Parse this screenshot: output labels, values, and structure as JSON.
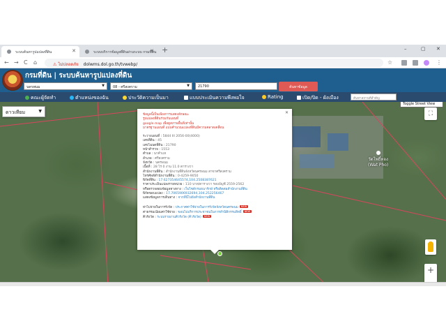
{
  "browser": {
    "tabs": [
      {
        "title": "ระบบค้นหารูปแปลงที่ดิน",
        "active": true
      },
      {
        "title": "ระบบบริการข้อมูลที่ดินผ่านระบบ กรมที่ดิน",
        "active": false
      }
    ],
    "new_tab_label": "+",
    "window_controls": {
      "minimize": "–",
      "maximize": "▢",
      "close": "✕"
    },
    "nav": {
      "back": "←",
      "forward": "→",
      "reload": "C",
      "home": "⌂"
    },
    "address": {
      "security_icon": "warning-icon",
      "insecure_label": "ไม่ปลอดภัย",
      "url": "dolwms.dol.go.th/tvwebp/"
    },
    "star_icon": "☆"
  },
  "app": {
    "logo_icon": "dol-seal",
    "title": "กรมที่ดิน | ระบบค้นหารูปแปลงที่ดิน",
    "search": {
      "province": "นครพนม",
      "district": "08 - ศรีสงคราม",
      "parcel_number": "21790",
      "search_button": "ค้นหาข้อมูล"
    },
    "menu": [
      {
        "label": "คณะผู้จัดทำ",
        "icon": "team-icon",
        "icon_color": "#4caf50"
      },
      {
        "label": "ตำแหน่งของฉัน",
        "icon": "location-icon",
        "icon_color": "#29b6f6"
      },
      {
        "label": "ประวัติความเป็นมา",
        "icon": "history-icon",
        "icon_color": "#fdd835"
      },
      {
        "label": "แบบประเมินความพึงพอใจ",
        "icon": "survey-icon",
        "icon_color": "#ffffff"
      },
      {
        "label": "Rating",
        "icon": "rating-icon",
        "icon_color": "#ffca28"
      },
      {
        "label": "เปิด/ปิด - ผังเมือง",
        "icon": "layers-icon",
        "icon_color": "#ffffff"
      }
    ],
    "place_search_placeholder": "ค้นหาสถานที่สำคัญ"
  },
  "map": {
    "type_button": "ดาวเทียม",
    "streetview_tooltip": "Toggle Street View",
    "place_label": "วัดโพธิ์ทอง",
    "place_label_sub": "(Wat Pho)",
    "zoom_in": "+",
    "zoom_out": "−",
    "parcel_line_color": "#d9455f"
  },
  "info_window": {
    "notice": [
      "ข้อมูลนี้เป็นเพียงการแสดงลักษณะ",
      "รูปแปลงที่ดินร่วมกับแผนที่",
      "google map เพื่อดูสภาพพื้นที่เท่านั้น",
      "มาตรฐานแผนที่ แบบคำนวณแปลงที่ดินมีความคลาดเคลื่อน"
    ],
    "fields": [
      {
        "label": "ระวางแผนที่",
        "value": "5844 III 2056-00(4000)"
      },
      {
        "label": "เลขที่ดิน",
        "value": "45"
      },
      {
        "label": "เลขโฉนดที่ดิน",
        "value": "21790"
      },
      {
        "label": "หน้าสำรวจ",
        "value": "1553"
      },
      {
        "label": "ตำบล",
        "value": "นาคำแห"
      },
      {
        "label": "อำเภอ",
        "value": "ศรีสงคราม"
      },
      {
        "label": "จังหวัด",
        "value": "นครพนม"
      },
      {
        "label": "เนื้อที่",
        "value": "28 ไร่ 0 งาน 11.0 ตารางวา"
      },
      {
        "label": "สำนักงานที่ดิน",
        "value": "สำนักงานที่ดินจังหวัดนครพนม สาขาศรีสงคราม"
      },
      {
        "label": "โทรศัพท์สำนักงานที่ดิน",
        "value": "0-4259-9050"
      },
      {
        "label": "พิกัดที่ดิน",
        "value": "17.627354645574,104.2508387621",
        "link": true
      },
      {
        "label": "ราคาประเมินแปลงรายหน่วย",
        "value": "110 บาท/ตารางวา รอบบัญชี 2559-2562"
      },
      {
        "label": "หรือตรวจสอบข้อมูลทางหาง",
        "value": "เว็บไซต์กรมธนารักษ์ หรือติดต่อสำนักงานที่ดิน",
        "link": true
      },
      {
        "label": "พิกัดขอบแปลง",
        "value": "17.7065906932694,104.252256467",
        "link": true
      },
      {
        "label": "แสดงข้อมูลการเดินทาง",
        "value": "จากที่นี่ไปยังสำนักงานที่ดิน",
        "link": true
      }
    ],
    "extra_links": [
      {
        "label": "ท่าไปจ่ายในการรังวัด",
        "value": "ประกาศค่าใช้จ่ายในการรังวัดจังหวัดนครพนม",
        "badge": "NEW"
      },
      {
        "label": "ค่าธรรมเนียมค่าใช้จ่าย",
        "value": "ขอบไปบริการประชาชนในการทำนิติกรรมสิทธิ์",
        "badge": "NEW"
      },
      {
        "label": "คิวรังวัด",
        "value": "ระบบรายงานคิวรังวัด (คิวรังวัด)",
        "badge": "NEW"
      }
    ],
    "close_label": "✕"
  }
}
